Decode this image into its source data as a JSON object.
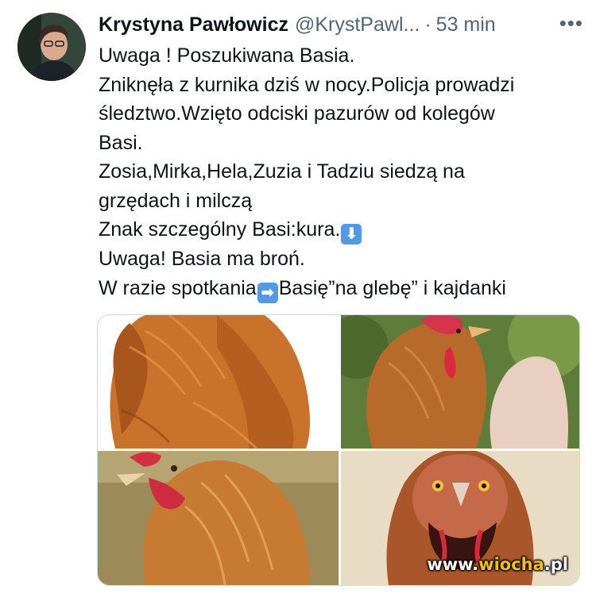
{
  "author": {
    "name": "Krystyna Pawłowicz",
    "handle": "@KrystPawl...",
    "separator": "·",
    "time": "53 min",
    "more_label": "•••"
  },
  "tweet": {
    "lines": [
      "Uwaga ! Poszukiwana Basia.",
      "Zniknęła z kurnika dziś w nocy.Policja prowadzi",
      "śledztwo.Wzięto odciski pazurów od kolegów",
      "Basi.",
      "Zosia,Mirka,Hela,Zuzia i Tadziu siedzą na",
      "grzędach i milczą",
      "Znak szczególny Basi:kura.",
      "Uwaga! Basia ma broń.",
      "W razie spotkania",
      "Basię”na glebę” i kajdanki"
    ],
    "emoji_down": "⬇",
    "emoji_right": "➡"
  },
  "media": {
    "photos": [
      "hen-back-photo",
      "hen-side-photo",
      "hen-profile-photo",
      "hen-front-photo"
    ]
  },
  "watermark": {
    "prefix": "www.",
    "brand": "wiocha",
    "suffix": ".pl"
  },
  "colors": {
    "text": "#0f1419",
    "muted": "#536471",
    "emoji_blue": "#4f9be8",
    "watermark_accent": "#f4c300"
  }
}
